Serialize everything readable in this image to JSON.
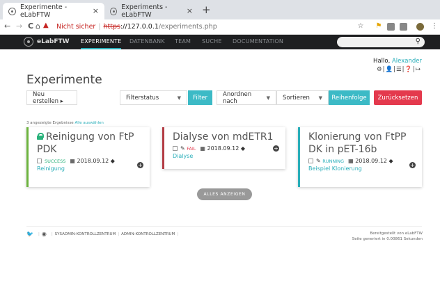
{
  "browser": {
    "tabs": [
      {
        "title": "Experimente - eLabFTW",
        "close": "×"
      },
      {
        "title": "Experiments - eLabFTW",
        "close": "×"
      }
    ],
    "new_tab": "+",
    "nav": {
      "back": "←",
      "forward": "→",
      "reload": "C",
      "home": "⌂"
    },
    "security_label": "Nicht sicher",
    "url": {
      "scheme": "https",
      "host": "://127.0.0.1",
      "path": "/experiments.php"
    }
  },
  "app": {
    "brand": "eLabFTW",
    "nav": [
      "EXPERIMENTE",
      "DATENBANK",
      "TEAM",
      "SUCHE",
      "DOCUMENTATION"
    ],
    "search_icon": "🔍",
    "greeting_prefix": "Hallo,",
    "user_name": "Alexander",
    "user_icons": "⚙|👤|☰|❓|↦"
  },
  "page": {
    "title": "Experimente",
    "create_label": "Neu erstellen ▸",
    "filter_status": "Filterstatus",
    "filter_btn": "Filter",
    "order_by": "Anordnen nach",
    "sort": "Sortieren",
    "order_btn": "Reihenfolge",
    "reset_btn": "Zurücksetzen",
    "results_text": "3 angezeigte Ergebnisse",
    "show_all_link": "Alle auswählen",
    "show_all_btn": "ALLES ANZEIGEN"
  },
  "experiments": [
    {
      "title": "Reinigung von FtP PDK",
      "status": "SUCCESS",
      "status_color": "#2ab27b",
      "date": "2018.09.12",
      "tag": "Reinigung",
      "border": "#6cb33e",
      "locked": true
    },
    {
      "title": "Dialyse von mdETR1",
      "status": "FAIL",
      "status_color": "#e4394d",
      "date": "2018.09.12",
      "tag": "Dialyse",
      "border": "#b33c44",
      "locked": false
    },
    {
      "title": "Klonierung von FtPP DK in pET-16b",
      "status": "RUNNING",
      "status_color": "#29aeb9",
      "date": "2018.09.12",
      "tag": "Beispiel Klonierung",
      "border": "#29aeb9",
      "locked": false
    }
  ],
  "footer": {
    "links": [
      "SYSADMIN-KONTROLLZENTRUM",
      "ADMIN-KONTROLLZENTRUM"
    ],
    "powered_by": "Bereitgestellt von eLabFTW",
    "generated": "Seite generiert in 0.00861 Sekunden"
  }
}
